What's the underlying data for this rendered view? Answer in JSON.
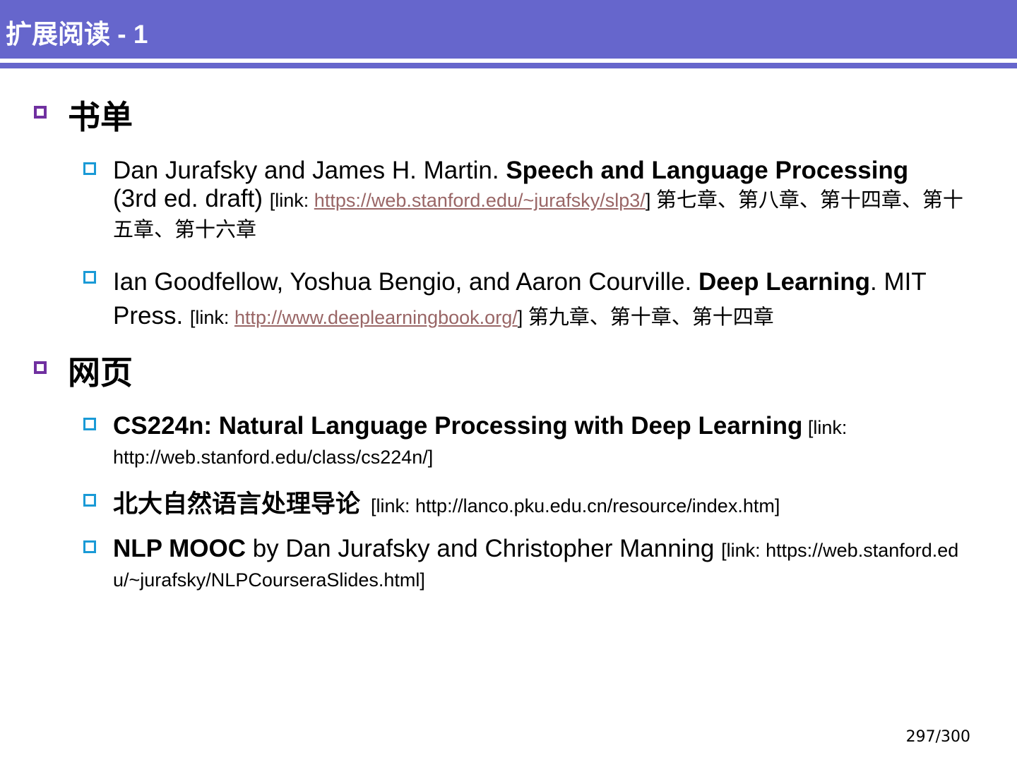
{
  "title": "扩展阅读 - 1",
  "sections": [
    {
      "heading": "书单",
      "items": [
        {
          "authors": "Dan Jurafsky and James H. Martin. ",
          "book": "Speech and Language Processing",
          "edition": "(3rd ed. draft) ",
          "link_prefix": "[link: ",
          "url": "https://web.stanford.edu/~jurafsky/slp3/",
          "link_suffix": "] ",
          "chapters": "第七章、第八章、第十四章、第十五章、第十六章"
        },
        {
          "authors": "Ian Goodfellow, Yoshua Bengio, and Aaron Courville. ",
          "book": "Deep Learning",
          "after": ". MIT Press. ",
          "link_prefix": "[link: ",
          "url": "http://www.deeplearningbook.org/",
          "link_suffix": "] ",
          "chapters": "第九章、第十章、第十四章"
        }
      ]
    },
    {
      "heading": "网页",
      "items": [
        {
          "name": "CS224n: Natural Language Processing with Deep Learning",
          "link": " [link: http://web.stanford.edu/class/cs224n/]"
        },
        {
          "name": "北大自然语言处理导论",
          "link": "  [link: http://lanco.pku.edu.cn/resource/index.htm]"
        },
        {
          "name": "NLP MOOC",
          "by": " by Dan Jurafsky and Christopher Manning ",
          "link": "[link: https://web.stanford.edu/~jurafsky/NLPCourseraSlides.html]"
        }
      ]
    }
  ],
  "page": "297/300"
}
